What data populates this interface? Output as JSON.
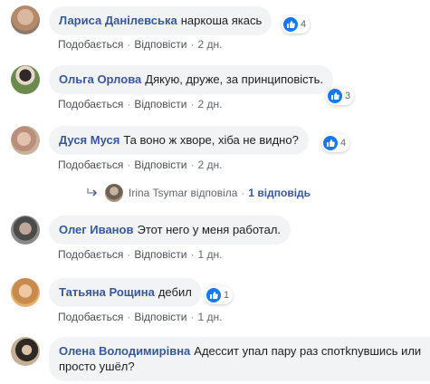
{
  "comments": [
    {
      "author": "Лариса Данілевська",
      "text": "наркоша якась",
      "reactions": "4",
      "like": "Подобається",
      "reply": "Відповісти",
      "time": "2 дн."
    },
    {
      "author": "Ольга Орлова",
      "text": "Дякую, друже, за принциповість.",
      "reactions": "3",
      "like": "Подобається",
      "reply": "Відповісти",
      "time": "2 дн."
    },
    {
      "author": "Дуся Муся",
      "text": "Та воно ж хворе, хіба не видно?",
      "reactions": "4",
      "like": "Подобається",
      "reply": "Відповісти",
      "time": "2 дн."
    },
    {
      "author": "Олег Иванов",
      "text": "Этот него у меня работал.",
      "like": "Подобається",
      "reply": "Відповісти",
      "time": "1 дн."
    },
    {
      "author": "Татьяна Рощина",
      "text": "дебил",
      "reactions": "1",
      "like": "Подобається",
      "reply": "Відповісти",
      "time": "1 дн."
    },
    {
      "author": "Олена Володимирівна",
      "text": "Адессит упал пару раз спотknувшись или просто ушёл?"
    }
  ],
  "replies_summary": {
    "author": "Irina Tsymar",
    "action": "відповіла",
    "count": "1 відповідь"
  },
  "colors": {
    "author": "#385898",
    "bubble": "#f2f3f5",
    "like_badge": "#1877f2",
    "meta": "#606770"
  }
}
